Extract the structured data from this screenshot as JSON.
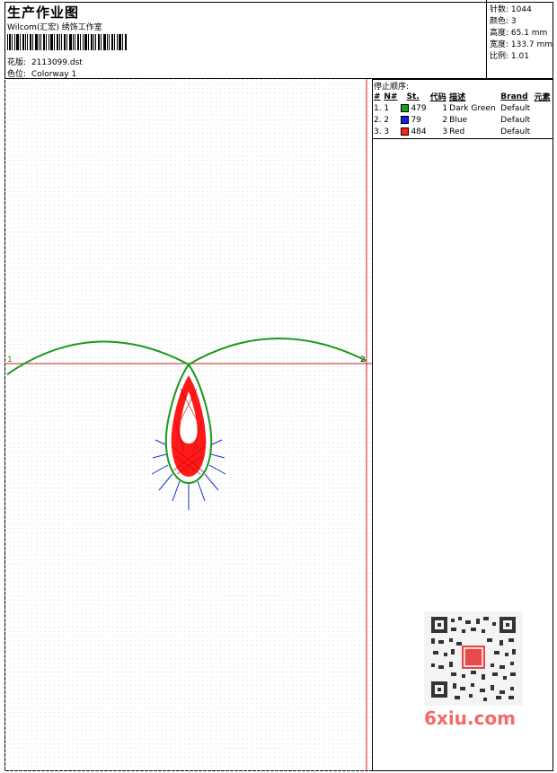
{
  "header": {
    "title": "生产作业图",
    "subtitle": "Wilcom(汇宏) 绣饰工作室",
    "design_label": "花版:",
    "design_file": "2113099.dst",
    "colorway_label": "色位:",
    "colorway": "Colorway 1"
  },
  "stats": {
    "stitches": "针数: 1044",
    "colors": "颜色: 3",
    "height": "高度: 65.1 mm",
    "width": "宽度: 133.7 mm",
    "scale": "比例: 1.01"
  },
  "design": {
    "marker_start": "1",
    "marker_end": "2",
    "colors": {
      "green": "#1a9a1a",
      "blue": "#1030d0",
      "red": "#ff1a1a",
      "guide": "#cc2222"
    }
  },
  "sequence": {
    "title": "停止顺序:",
    "headers": [
      "#",
      "N#",
      "St.",
      "代码",
      "描述",
      "Brand",
      "元素"
    ],
    "rows": [
      {
        "idx": "1.",
        "num": "1",
        "color": "#1aa01a",
        "stitches": "479",
        "code": "1",
        "desc": "Dark Green",
        "brand": "Default"
      },
      {
        "idx": "2.",
        "num": "2",
        "color": "#1020e0",
        "stitches": "79",
        "code": "2",
        "desc": "Blue",
        "brand": "Default"
      },
      {
        "idx": "3.",
        "num": "3",
        "color": "#ff2020",
        "stitches": "484",
        "code": "3",
        "desc": "Red",
        "brand": "Default"
      }
    ]
  },
  "watermark": {
    "site": "6xiu.com"
  }
}
